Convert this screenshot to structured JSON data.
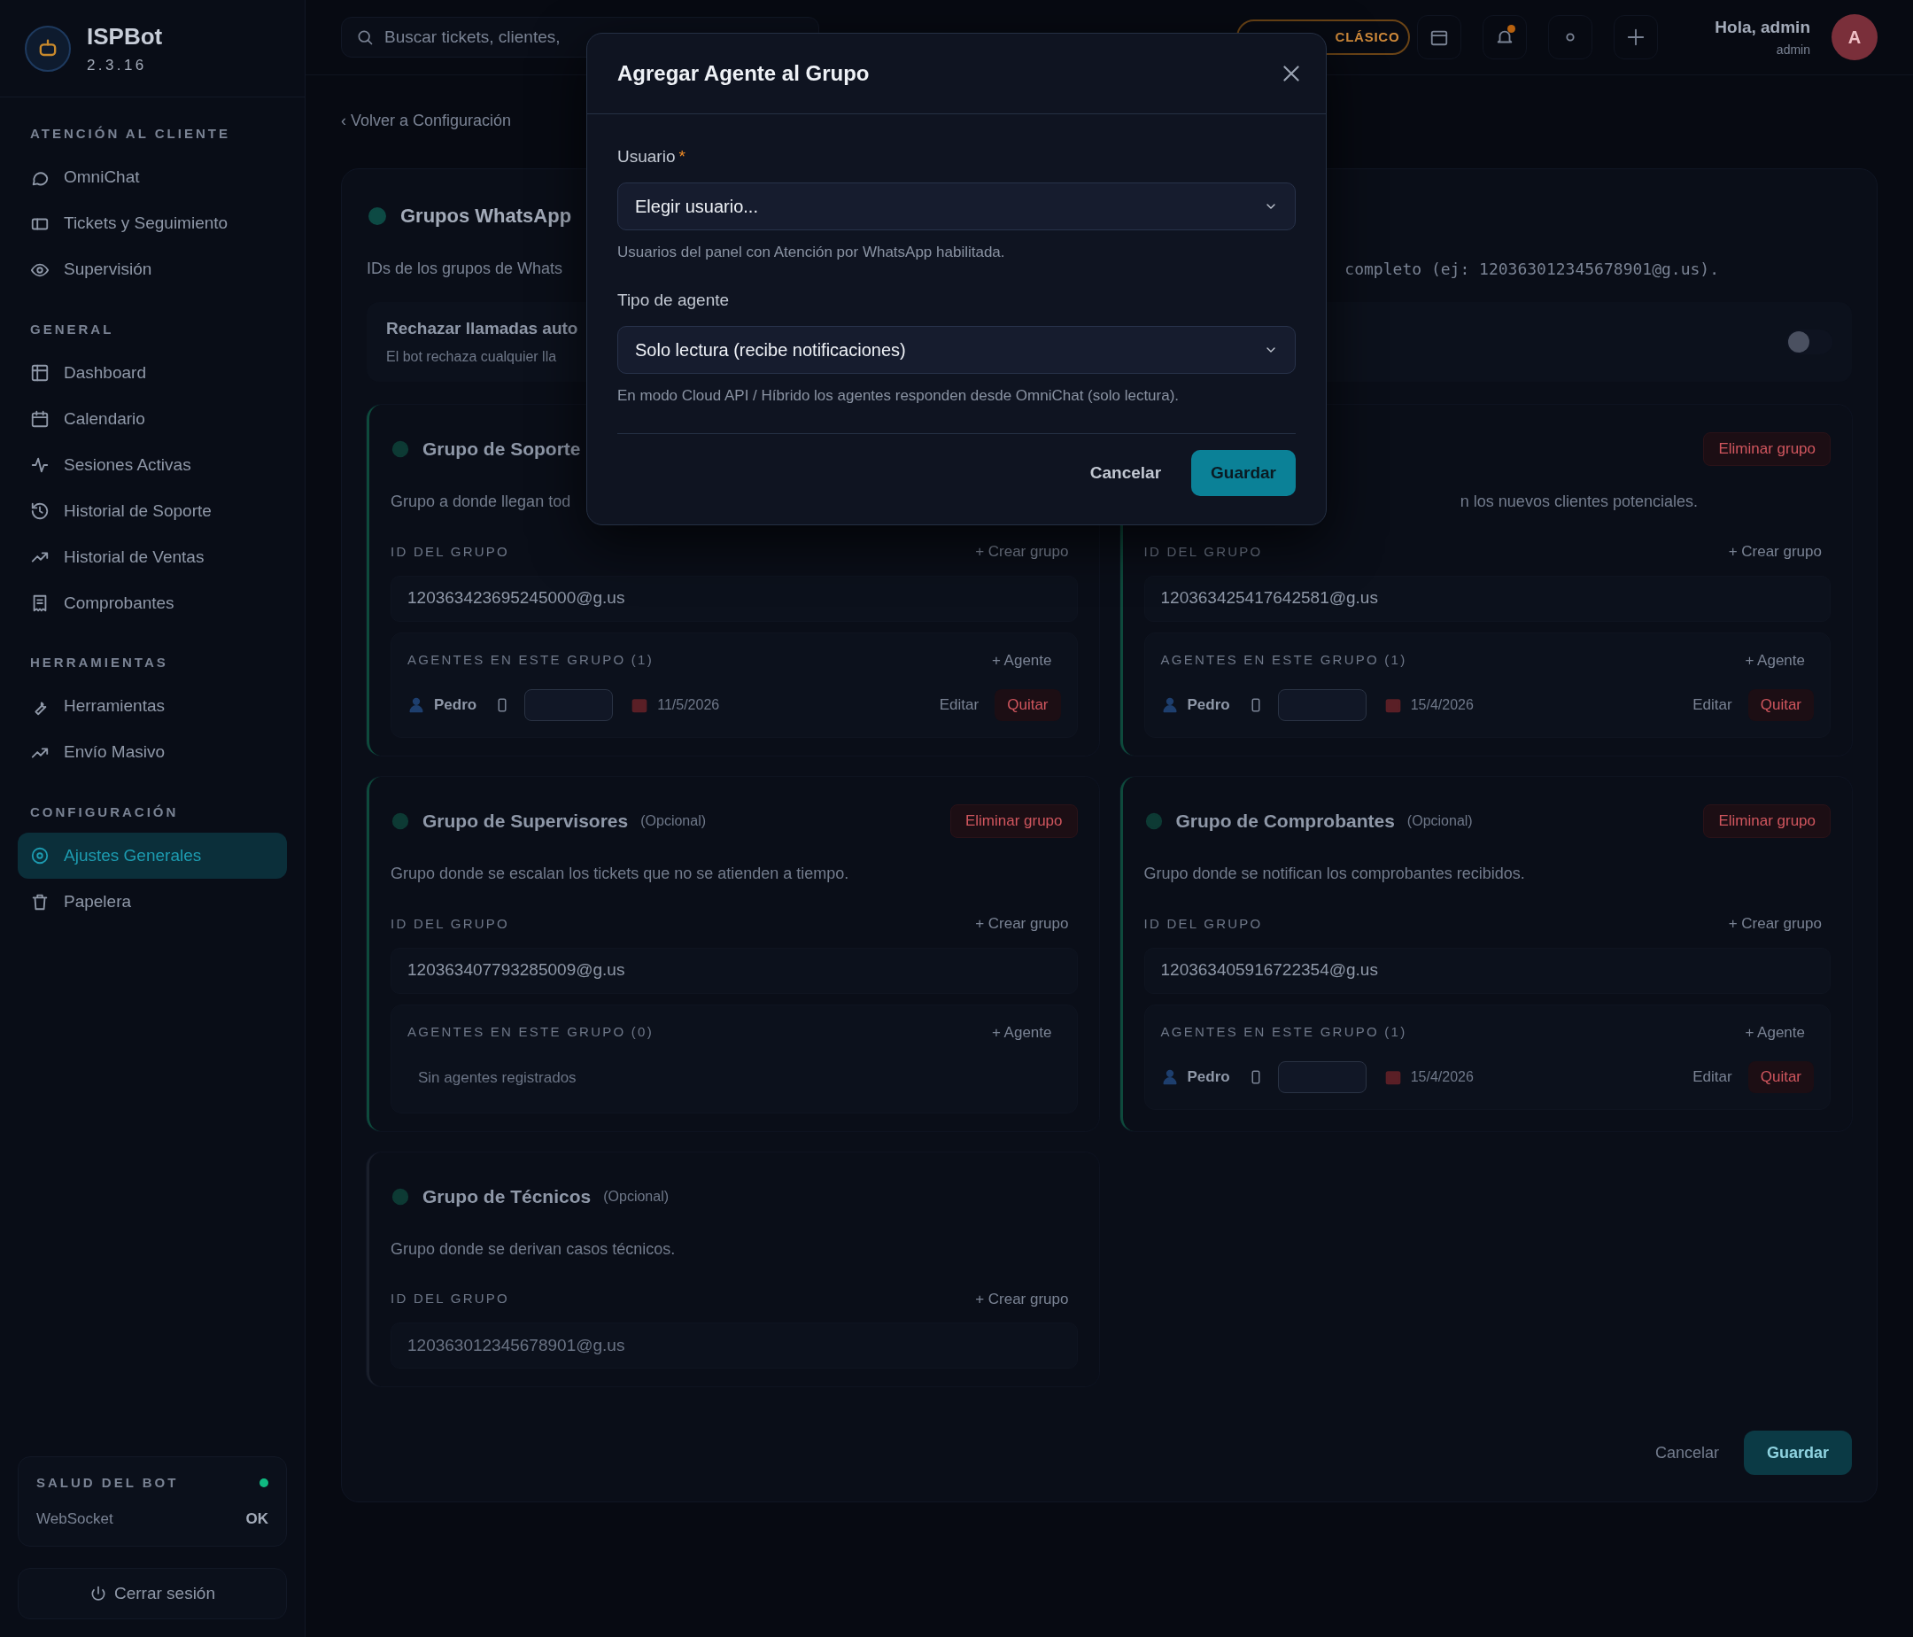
{
  "sidebar": {
    "brand": "ISPBot",
    "version": "2.3.16",
    "sections": [
      {
        "title": "ATENCIÓN AL CLIENTE",
        "items": [
          {
            "label": "OmniChat",
            "selected": false
          },
          {
            "label": "Tickets y Seguimiento",
            "selected": false
          },
          {
            "label": "Supervisión",
            "selected": false
          }
        ]
      },
      {
        "title": "GENERAL",
        "items": [
          {
            "label": "Dashboard",
            "selected": false
          },
          {
            "label": "Calendario",
            "selected": false
          },
          {
            "label": "Sesiones Activas",
            "selected": false
          },
          {
            "label": "Historial de Soporte",
            "selected": false
          },
          {
            "label": "Historial de Ventas",
            "selected": false
          },
          {
            "label": "Comprobantes",
            "selected": false
          }
        ]
      },
      {
        "title": "HERRAMIENTAS",
        "items": [
          {
            "label": "Herramientas",
            "selected": false
          },
          {
            "label": "Envío Masivo",
            "selected": false
          }
        ]
      },
      {
        "title": "CONFIGURACIÓN",
        "items": [
          {
            "label": "Ajustes Generales",
            "selected": true
          },
          {
            "label": "Papelera",
            "selected": false
          }
        ]
      }
    ],
    "health": {
      "title": "SALUD DEL BOT",
      "color": "#10b981",
      "rows": [
        {
          "label": "WebSocket",
          "value": "OK"
        }
      ]
    },
    "logout": "Cerrar sesión"
  },
  "topbar": {
    "search_placeholder": "Buscar tickets, clientes,",
    "mode_badge": "CLÁSICO",
    "notification_dot": true,
    "greeting": "Hola, admin",
    "role": "admin",
    "avatar_initial": "A"
  },
  "back_link": "‹ Volver a Configuración",
  "panel": {
    "title": "Grupos WhatsApp",
    "description_left": "IDs de los grupos de Whats",
    "description_right": "completo (ej: 120363012345678901@g.us).",
    "toggle": {
      "label": "Rechazar llamadas auto",
      "hint": "El bot rechaza cualquier lla",
      "on": false
    },
    "groups": [
      {
        "title": "Grupo de Soporte",
        "configured": true,
        "description": "Grupo a donde llegan tod",
        "id_label": "ID DEL GRUPO",
        "create": "+ Crear grupo",
        "id_value": "120363423695245000@g.us",
        "agents": {
          "title": "AGENTES EN ESTE GRUPO (1)",
          "add": "+ Agente",
          "rows": [
            {
              "name": "Pedro",
              "date": "11/5/2026",
              "edit": "Editar",
              "remove": "Quitar"
            }
          ]
        }
      },
      {
        "configured": true,
        "delete": "Eliminar grupo",
        "description": "n los nuevos clientes potenciales.",
        "id_label": "ID DEL GRUPO",
        "create": "+ Crear grupo",
        "id_value": "120363425417642581@g.us",
        "agents": {
          "title": "AGENTES EN ESTE GRUPO (1)",
          "add": "+ Agente",
          "rows": [
            {
              "name": "Pedro",
              "date": "15/4/2026",
              "edit": "Editar",
              "remove": "Quitar"
            }
          ]
        }
      },
      {
        "title": "Grupo de Supervisores",
        "optional": "(Opcional)",
        "configured": true,
        "delete": "Eliminar grupo",
        "description": "Grupo donde se escalan los tickets que no se atienden a tiempo.",
        "id_label": "ID DEL GRUPO",
        "create": "+ Crear grupo",
        "id_value": "120363407793285009@g.us",
        "agents": {
          "title": "AGENTES EN ESTE GRUPO (0)",
          "add": "+ Agente",
          "empty": "Sin agentes registrados"
        }
      },
      {
        "title": "Grupo de Comprobantes",
        "optional": "(Opcional)",
        "configured": true,
        "delete": "Eliminar grupo",
        "description": "Grupo donde se notifican los comprobantes recibidos.",
        "id_label": "ID DEL GRUPO",
        "create": "+ Crear grupo",
        "id_value": "120363405916722354@g.us",
        "agents": {
          "title": "AGENTES EN ESTE GRUPO (1)",
          "add": "+ Agente",
          "rows": [
            {
              "name": "Pedro",
              "date": "15/4/2026",
              "edit": "Editar",
              "remove": "Quitar"
            }
          ]
        }
      },
      {
        "title": "Grupo de Técnicos",
        "optional": "(Opcional)",
        "configured": false,
        "description": "Grupo donde se derivan casos técnicos.",
        "id_label": "ID DEL GRUPO",
        "create": "+ Crear grupo",
        "id_placeholder": "120363012345678901@g.us"
      }
    ],
    "footer": {
      "cancel": "Cancelar",
      "save": "Guardar"
    }
  },
  "modal": {
    "title": "Agregar Agente al Grupo",
    "fields": [
      {
        "label": "Usuario",
        "required_mark": "*",
        "value": "Elegir usuario...",
        "hint": "Usuarios del panel con Atención por WhatsApp habilitada."
      },
      {
        "label": "Tipo de agente",
        "value": "Solo lectura (recibe notificaciones)",
        "hint": "En modo Cloud API / Híbrido los agentes responden desde OmniChat (solo lectura)."
      }
    ],
    "cancel": "Cancelar",
    "save": "Guardar"
  }
}
